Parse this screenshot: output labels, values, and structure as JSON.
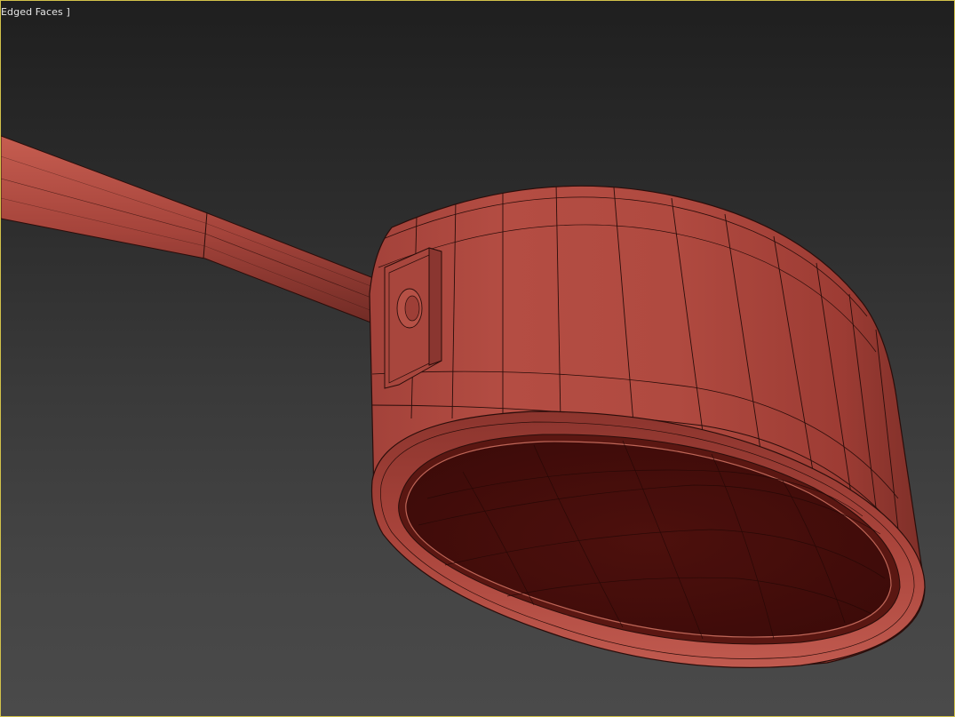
{
  "viewport": {
    "label": "Edged Faces ]",
    "border_color": "#d2c24a",
    "background_top": "#1f1f1f",
    "background_bottom": "#4a4a4a"
  },
  "scene": {
    "object": "saucepan",
    "display_mode": "edged-faces",
    "mesh_color": "#b04a40",
    "wire_color": "#2a0d0a",
    "interior_color": "#4a0f0c"
  }
}
